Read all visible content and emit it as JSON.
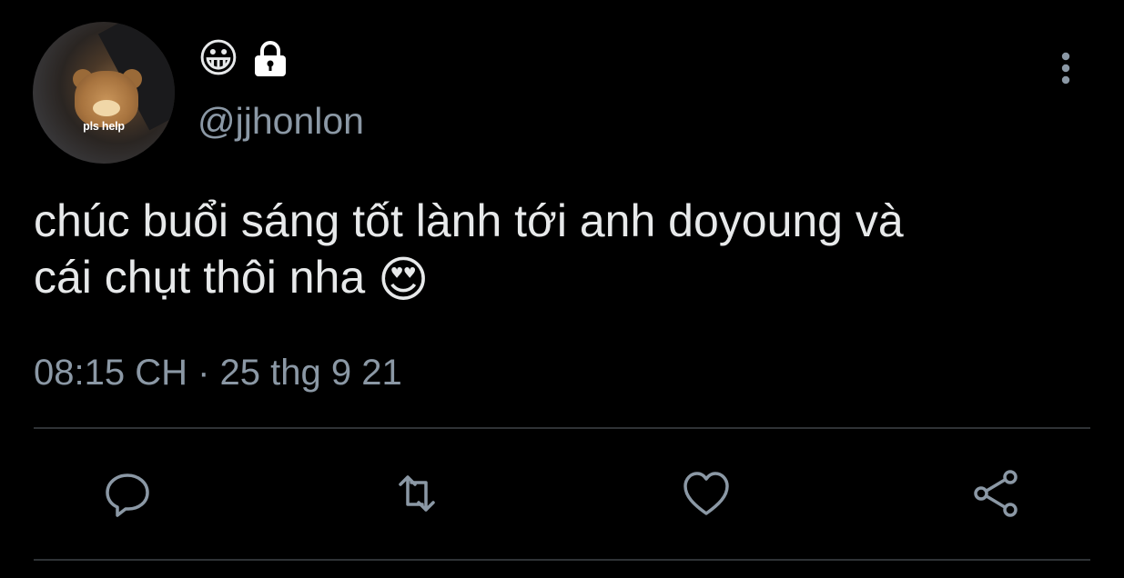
{
  "user": {
    "avatar_caption": "pls help",
    "display_name_emoji": "😀",
    "handle": "@jjhonlon",
    "protected_icon": "lock-icon"
  },
  "tweet": {
    "text_line1": "chúc buổi sáng tốt lành tới anh doyoung và",
    "text_line2": "cái chụt thôi nha",
    "text_emoji": "😍",
    "timestamp": "08:15 CH · 25 thg 9 21"
  },
  "actions": {
    "reply_icon": "speech-bubble-icon",
    "retweet_icon": "retweet-icon",
    "like_icon": "heart-icon",
    "share_icon": "share-icon",
    "more_icon": "vertical-ellipsis-icon"
  },
  "colors": {
    "background": "#000000",
    "text": "#e7e9ea",
    "secondary": "#8b98a5",
    "divider": "#2f3336"
  }
}
